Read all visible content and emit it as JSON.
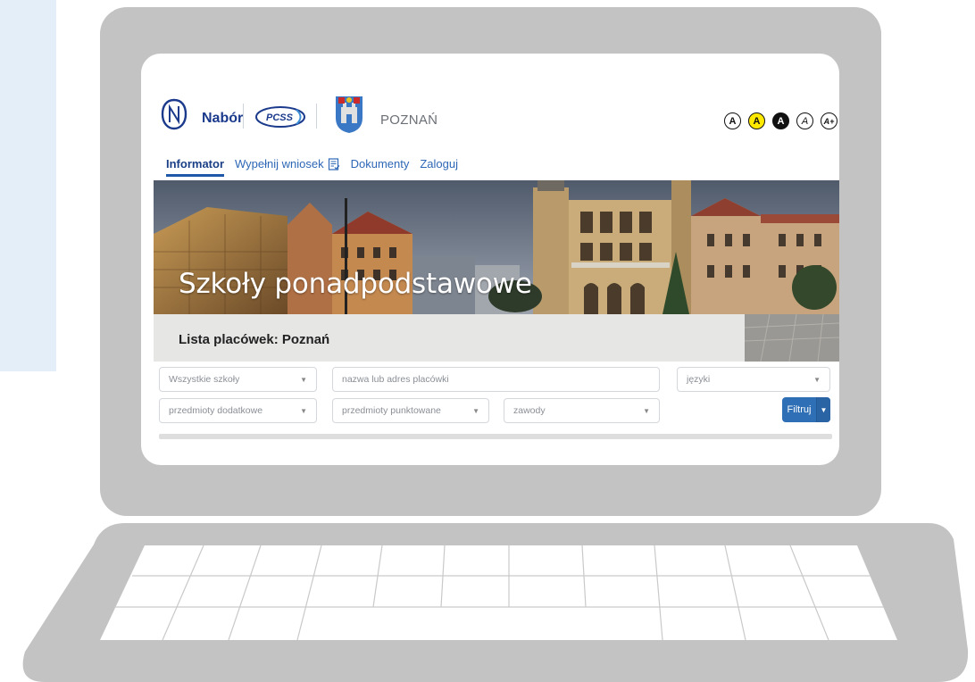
{
  "header": {
    "brand_name": "Nabór",
    "pcss_label": "PCSS",
    "city_name": "POZNAŃ",
    "accessibility_buttons": [
      {
        "label": "A",
        "style": "plain"
      },
      {
        "label": "A",
        "style": "yellow"
      },
      {
        "label": "A",
        "style": "black"
      },
      {
        "label": "A",
        "style": "italic"
      },
      {
        "label": "A+",
        "style": "plus"
      }
    ]
  },
  "nav": {
    "items": [
      {
        "label": "Informator",
        "active": true
      },
      {
        "label": "Wypełnij wniosek",
        "active": false,
        "icon": "document-form-icon"
      },
      {
        "label": "Dokumenty",
        "active": false
      },
      {
        "label": "Zaloguj",
        "active": false
      }
    ]
  },
  "hero": {
    "title": "Szkoły ponadpodstawowe",
    "subtitle": "Lista placówek: Poznań"
  },
  "filters": {
    "schools_select": "Wszystkie szkoły",
    "search_placeholder": "nazwa lub adres placówki",
    "languages_select": "języki",
    "extra_subjects_select": "przedmioty dodatkowe",
    "scored_subjects_select": "przedmioty punktowane",
    "professions_select": "zawody",
    "filter_button": "Filtruj"
  },
  "colors": {
    "brand_blue": "#1b3a8c",
    "link_blue": "#2d67b6",
    "button_blue": "#2f6fb5",
    "laptop_gray": "#c3c3c3",
    "accent_yellow": "#ffe900"
  }
}
